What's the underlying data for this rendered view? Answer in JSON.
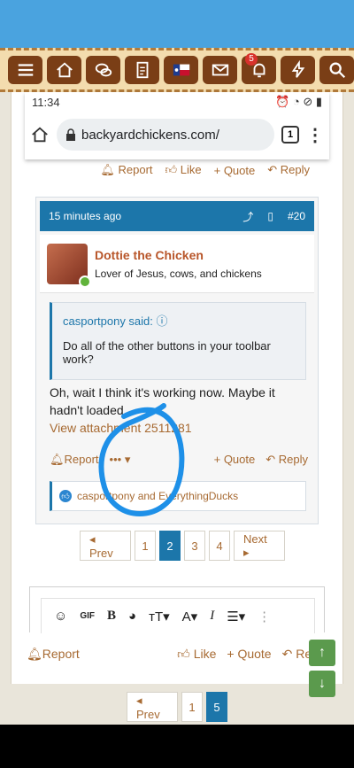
{
  "navbar": {
    "items": [
      {
        "icon": "menu-icon"
      },
      {
        "icon": "home-icon"
      },
      {
        "icon": "chat-icon"
      },
      {
        "icon": "document-icon"
      },
      {
        "icon": "texas-flag-icon"
      },
      {
        "icon": "mail-icon"
      },
      {
        "icon": "bell-icon",
        "badge": "5"
      },
      {
        "icon": "lightning-icon"
      },
      {
        "icon": "search-icon"
      }
    ]
  },
  "phone": {
    "time": "11:34"
  },
  "browser": {
    "url": "backyardchickens.com/",
    "tabs": "1"
  },
  "prev_post_actions": {
    "report": "Report",
    "like": "Like",
    "quote": "+ Quote",
    "reply": "Reply"
  },
  "post": {
    "time": "15 minutes ago",
    "number": "#20",
    "author": "Dottie the Chicken",
    "user_title": "Lover of Jesus, cows, and chickens",
    "quote_author": "casportpony said:",
    "quote_text": "Do all of the other buttons in your toolbar work?",
    "message": "Oh, wait I think it's working now. Maybe it hadn't loaded.",
    "attachment": "View attachment 2511281",
    "report": "Report",
    "more": "••• ▾",
    "quote": "+ Quote",
    "reply": "Reply",
    "likes": "casportpony and EverythingDucks"
  },
  "pager1": {
    "prev": "◂ Prev",
    "pages": [
      "1",
      "2",
      "3",
      "4"
    ],
    "current": "2",
    "next": "Next ▸"
  },
  "bottom_actions": {
    "report": "Report",
    "like": "Like",
    "quote": "+ Quote",
    "reply": "Reply"
  },
  "pager2": {
    "prev": "◂ Prev",
    "pages": [
      "1",
      "5"
    ],
    "current": "5"
  },
  "colors": {
    "accent": "#1c76aa",
    "link": "#a76a32",
    "navbar_button": "#7a3e16",
    "scribble": "#1e90e8"
  }
}
